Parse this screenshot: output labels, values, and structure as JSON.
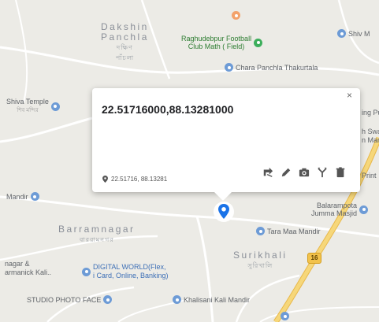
{
  "map": {
    "areas": {
      "dakshin_line1": "Dakshin",
      "dakshin_line2": "Panchla",
      "dakshin_local1": "দক্ষিণ",
      "dakshin_local2": "পাঁচলা",
      "barramnagar": "Barramnagar",
      "barramnagar_local": "বাররামনগর",
      "surikhali": "Surikhali",
      "surikhali_local": "সুরিখালি"
    },
    "places": {
      "football_club": "Raghudebpur Football\nClub Math ( Field)",
      "shiv_mandir": "Shiv M",
      "chara_panchla": "Chara Panchla Thakurtala",
      "shiva_temple": "Shiva Temple",
      "shiva_temple_local": "শিব মন্দির",
      "mandir_left": "Mandir",
      "balarampota_line1": "Balarampota",
      "balarampota_line2": "Jumma Masjid",
      "tara_maa": "Tara Maa Mandir",
      "nagar_line1": "nagar &",
      "nagar_line2": "armanick Kali..",
      "digital_world_line1": "DIGITAL WORLD(Flex,",
      "digital_world_line2": "i Card, Online, Banking)",
      "studio_photo": "STUDIO PHOTO FACE",
      "khalisani": "Khalisani Kali Mandir",
      "right_edge_1": "ing Pu",
      "right_edge_2": "h Swa",
      "right_edge_3": "n Man",
      "right_edge_4": "Print",
      "road_shield": "16"
    },
    "colors": {
      "land": "#ecebe6",
      "road": "#ffffff",
      "highway": "#f6cf65",
      "marker": "#1a73e8",
      "poi_green": "#3cae5b",
      "poi_blue": "#6d9bd6"
    }
  },
  "popup": {
    "title": "22.51716000,88.13281000",
    "coords": "22.51716, 88.13281",
    "close": "×",
    "tools": [
      "directions-icon",
      "edit-icon",
      "camera-icon",
      "share-icon",
      "delete-icon"
    ]
  }
}
